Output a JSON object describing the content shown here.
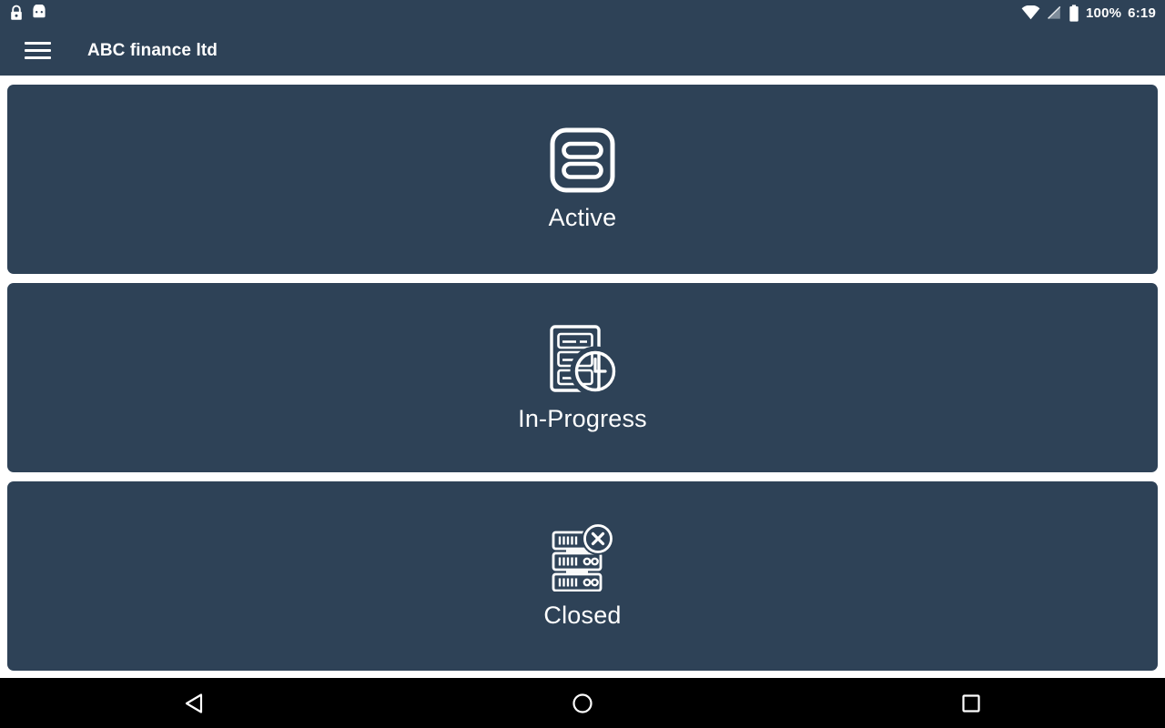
{
  "status_bar": {
    "left_icons": [
      {
        "name": "lock-icon",
        "label": "lock"
      },
      {
        "name": "android-robot-icon",
        "label": "android"
      }
    ],
    "right_icons": [
      {
        "name": "wifi-icon",
        "label": "wifi"
      },
      {
        "name": "no-signal-icon",
        "label": "no-signal"
      },
      {
        "name": "battery-icon",
        "label": "battery"
      }
    ],
    "battery_percent": "100%",
    "clock": "6:19"
  },
  "app_bar": {
    "menu_icon": "hamburger-menu-icon",
    "title": "ABC finance ltd"
  },
  "cards": [
    {
      "label": "Active",
      "icon": "active-list-icon"
    },
    {
      "label": "In-Progress",
      "icon": "document-clock-icon"
    },
    {
      "label": "Closed",
      "icon": "server-close-icon"
    }
  ],
  "nav_bar": {
    "back_label": "Back",
    "home_label": "Home",
    "recents_label": "Recents"
  },
  "colors": {
    "surface": "#2e4257",
    "background": "#ffffff",
    "on_surface": "#ffffff",
    "nav_bar": "#000000"
  }
}
